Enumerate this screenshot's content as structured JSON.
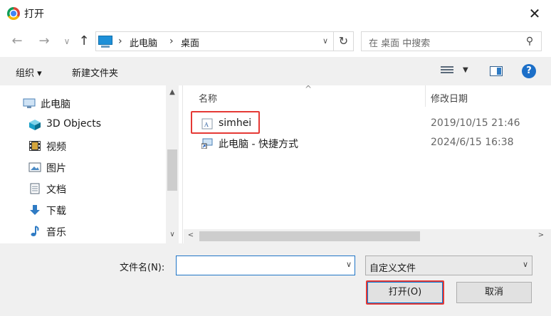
{
  "window": {
    "title": "打开"
  },
  "nav": {
    "back": "←",
    "forward": "→",
    "recent": "∨",
    "up": "↑",
    "breadcrumb": [
      "此电脑",
      "桌面"
    ],
    "search_placeholder": "在 桌面 中搜索"
  },
  "toolbar": {
    "organize": "组织 ▾",
    "new_folder": "新建文件夹"
  },
  "sidebar": {
    "items": [
      {
        "label": "此电脑",
        "icon": "computer-icon"
      },
      {
        "label": "3D Objects",
        "icon": "cube-icon"
      },
      {
        "label": "视频",
        "icon": "film-icon"
      },
      {
        "label": "图片",
        "icon": "picture-icon"
      },
      {
        "label": "文档",
        "icon": "document-icon"
      },
      {
        "label": "下载",
        "icon": "download-icon"
      },
      {
        "label": "音乐",
        "icon": "music-icon"
      }
    ]
  },
  "files": {
    "columns": {
      "name": "名称",
      "modified": "修改日期"
    },
    "rows": [
      {
        "name": "simhei",
        "modified": "2019/10/15 21:46",
        "icon": "font-file-icon",
        "highlighted": true
      },
      {
        "name": "此电脑 - 快捷方式",
        "modified": "2024/6/15 16:38",
        "icon": "shortcut-icon",
        "highlighted": false
      }
    ]
  },
  "footer": {
    "filename_label": "文件名(N):",
    "filename_value": "",
    "filetype_value": "自定义文件",
    "open_label": "打开(O)",
    "cancel_label": "取消"
  },
  "colors": {
    "highlight": "#e53935",
    "accent": "#0078d7"
  }
}
